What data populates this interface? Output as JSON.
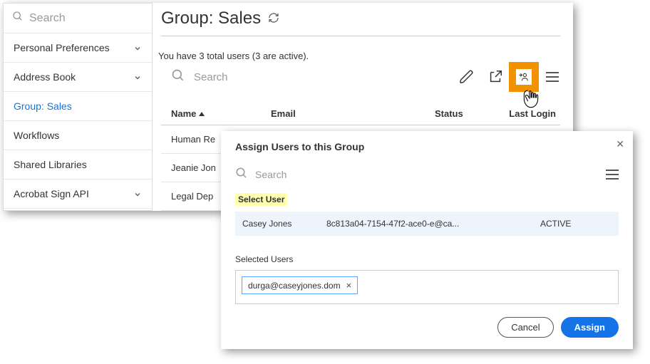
{
  "sidebar": {
    "search_placeholder": "Search",
    "items": [
      {
        "label": "Personal Preferences",
        "expandable": true
      },
      {
        "label": "Address Book",
        "expandable": true
      },
      {
        "label": "Group: Sales",
        "expandable": false,
        "active": true
      },
      {
        "label": "Workflows",
        "expandable": false
      },
      {
        "label": "Shared Libraries",
        "expandable": false
      },
      {
        "label": "Acrobat Sign API",
        "expandable": true
      }
    ]
  },
  "header": {
    "title": "Group: Sales"
  },
  "users_count_line": "You have 3 total users (3 are active).",
  "toolbar": {
    "search_placeholder": "Search"
  },
  "columns": {
    "name": "Name",
    "email": "Email",
    "status": "Status",
    "last_login": "Last Login"
  },
  "rows": [
    {
      "name": "Human Re"
    },
    {
      "name": "Jeanie Jon"
    },
    {
      "name": "Legal Dep"
    }
  ],
  "modal": {
    "title": "Assign Users to this Group",
    "search_placeholder": "Search",
    "select_user_label": "Select User",
    "candidate": {
      "name": "Casey Jones",
      "email": "8c813a04-7154-47f2-ace0-e@ca...",
      "status": "ACTIVE"
    },
    "selected_users_label": "Selected Users",
    "selected_chip": "durga@caseyjones.dom",
    "cancel": "Cancel",
    "assign": "Assign"
  }
}
